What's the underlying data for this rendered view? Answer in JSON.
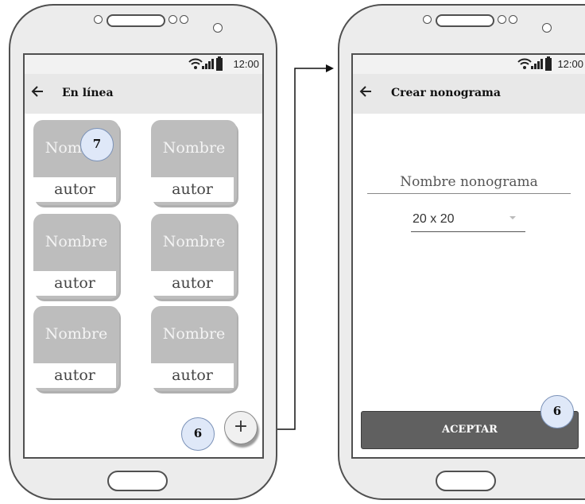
{
  "left_phone": {
    "status_time": "12:00",
    "title": "En línea",
    "cards": [
      {
        "name": "Nombre",
        "author": "autor"
      },
      {
        "name": "Nombre",
        "author": "autor"
      },
      {
        "name": "Nombre",
        "author": "autor"
      },
      {
        "name": "Nombre",
        "author": "autor"
      },
      {
        "name": "Nombre",
        "author": "autor"
      },
      {
        "name": "Nombre",
        "author": "autor"
      }
    ],
    "card_badge": "7",
    "fab_badge": "6",
    "fab_label": "+"
  },
  "right_phone": {
    "status_time": "12:00",
    "title": "Crear nonograma",
    "name_placeholder": "Nombre nonograma",
    "size_value": "20 x 20",
    "accept_label": "ACEPTAR",
    "accept_badge": "6"
  },
  "colors": {
    "phone_body": "#ececec",
    "card": "#bdbdbd",
    "badge_fill": "#dfe8f8",
    "badge_border": "#7b92b8",
    "accept_button": "#606060"
  }
}
